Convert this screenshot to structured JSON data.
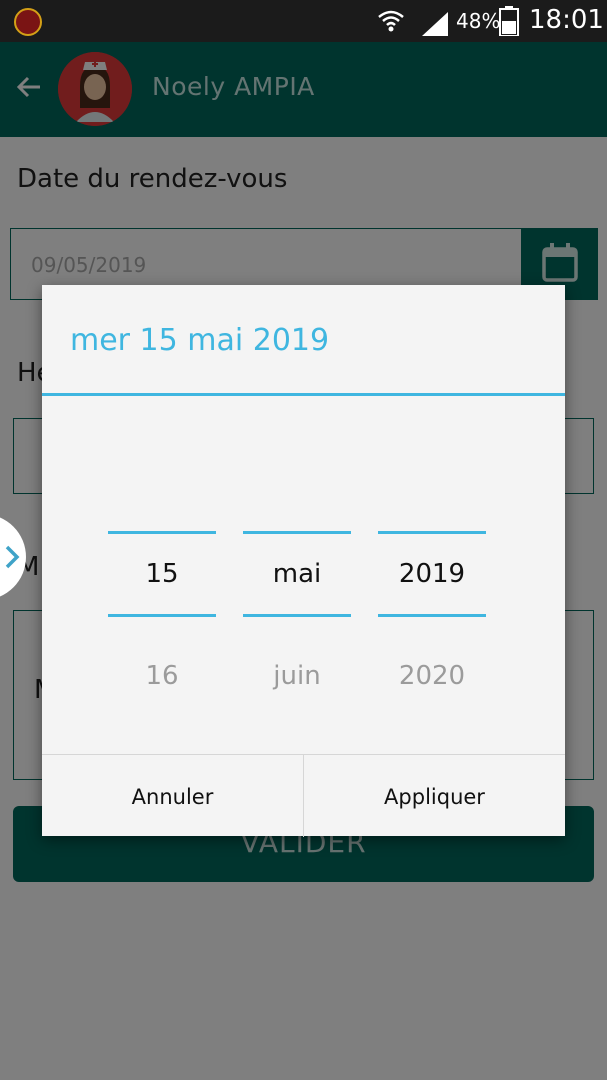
{
  "status_bar": {
    "battery_percent": "48%",
    "time": "18:01"
  },
  "app_bar": {
    "title": "Noely AMPIA"
  },
  "form": {
    "date_label": "Date du rendez-vous",
    "date_value": "09/05/2019",
    "heure_label": "He",
    "motif_label": "M",
    "motif_placeholder": "M",
    "submit_label": "VALIDER"
  },
  "date_dialog": {
    "header": "mer 15 mai 2019",
    "day": {
      "selected": "15",
      "next": "16"
    },
    "month": {
      "selected": "mai",
      "next": "juin"
    },
    "year": {
      "selected": "2019",
      "next": "2020"
    },
    "cancel_label": "Annuler",
    "apply_label": "Appliquer"
  },
  "colors": {
    "primary": "#00695c",
    "accent": "#3fb6e0",
    "status_bar": "#1b1b1b"
  }
}
